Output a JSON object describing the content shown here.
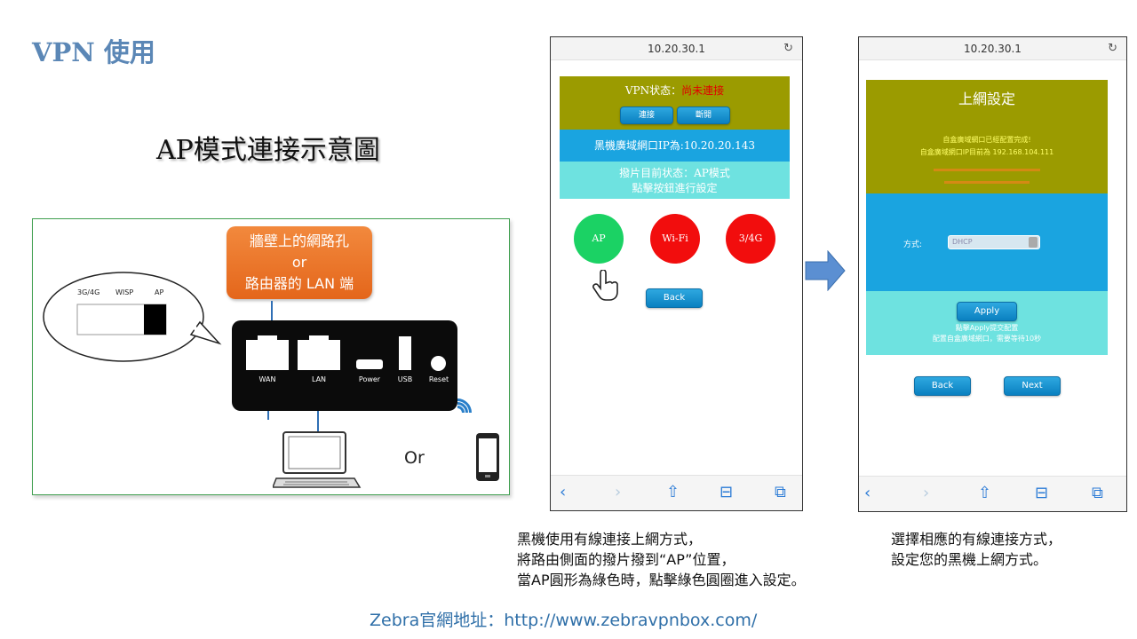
{
  "slide": {
    "title": "VPN 使用",
    "diagram_title": "AP模式連接示意圖",
    "footer": "Zebra官網地址：http://www.zebravpnbox.com/"
  },
  "diagram": {
    "switch_labels": [
      "3G/4G",
      "WISP",
      "AP"
    ],
    "callout_lines": [
      "牆壁上的網路孔",
      "or",
      "路由器的 LAN 端"
    ],
    "port_labels": [
      "WAN",
      "LAN",
      "Power",
      "USB",
      "Reset"
    ],
    "or_label": "Or"
  },
  "phone1": {
    "address": "10.20.30.1",
    "reload_icon": "↻",
    "vpn_status_label": "VPN状态：",
    "vpn_status_value": "尚未連接",
    "connect_button": "連接",
    "disconnect_button": "斷開",
    "wan_ip": "黑機廣域網口IP為:10.20.20.143",
    "mode_status": "撥片目前状态：AP模式",
    "mode_hint": "點擊按鈕進行設定",
    "circles": [
      "AP",
      "Wi-Fi",
      "3/4G"
    ],
    "back_button": "Back",
    "colors": {
      "olive": "#9b9b00",
      "blue": "#1aa4e0",
      "cyan": "#6ee2e0",
      "ap": "#1bd264",
      "red": "#f20d0d"
    }
  },
  "phone2": {
    "address": "10.20.30.1",
    "reload_icon": "↻",
    "title": "上網設定",
    "msg1": "自盒廣域網口已經配置完成!",
    "msg2": "自盒廣域網口IP目前為 192.168.104.111",
    "method_label": "方式:",
    "method_value": "DHCP",
    "apply_button": "Apply",
    "apply_hint1": "點擊Apply提交配置",
    "apply_hint2": "配置自盒廣域網口，需要等待10秒",
    "back_button": "Back",
    "next_button": "Next"
  },
  "nav_icons": [
    "‹",
    "›",
    "⇧",
    "⊟",
    "⧉"
  ],
  "arrow_icon": "right-arrow",
  "caption1": [
    "黑機使用有線連接上網方式，",
    "將路由側面的撥片撥到“AP”位置，",
    "當AP圓形為綠色時，點擊綠色圓圈進入設定。"
  ],
  "caption2": [
    "選擇相應的有線連接方式，",
    "設定您的黑機上網方式。"
  ]
}
